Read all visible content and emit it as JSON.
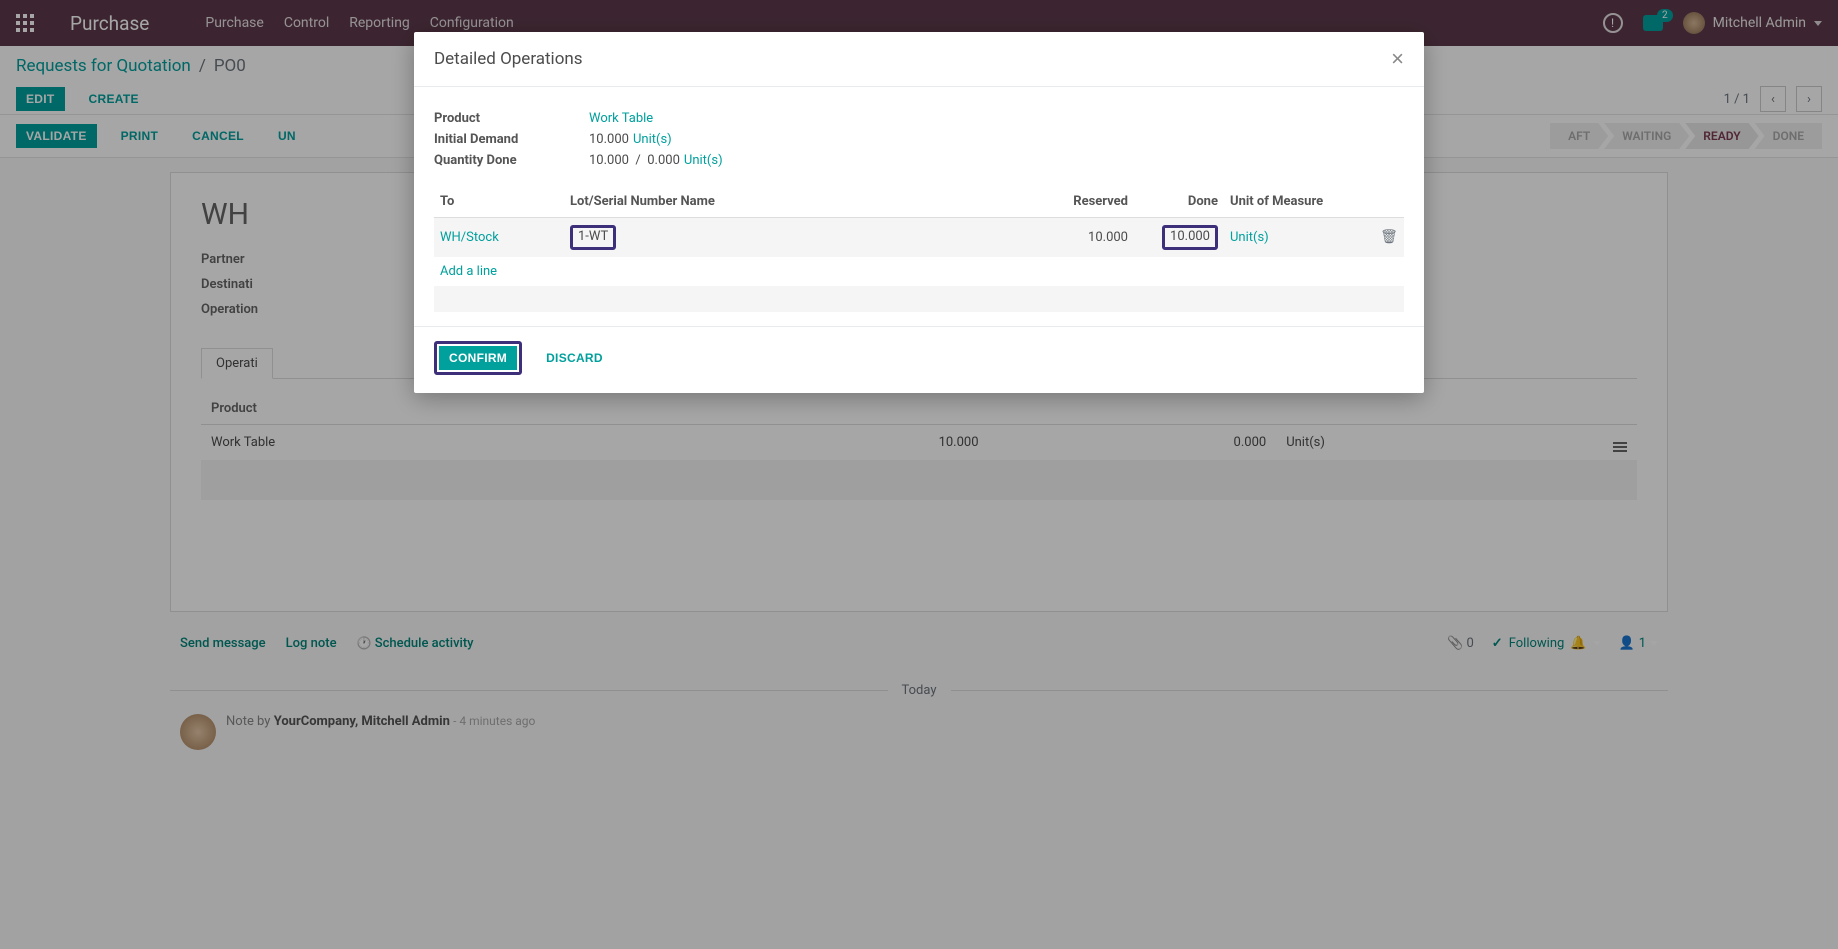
{
  "topbar": {
    "brand": "Purchase",
    "menu": [
      "Purchase",
      "Control",
      "Reporting",
      "Configuration"
    ],
    "chat_badge": "2",
    "user_name": "Mitchell Admin"
  },
  "breadcrumb": {
    "root": "Requests for Quotation",
    "current": "PO0",
    "edit": "Edit",
    "create": "Create",
    "pager": "1 / 1"
  },
  "statusbar": {
    "validate": "Validate",
    "print": "Print",
    "cancel": "Cancel",
    "un": "Un",
    "stages": [
      "aft",
      "Waiting",
      "Ready",
      "Done"
    ],
    "active_stage_index": 2
  },
  "sheet": {
    "doc_title": "WH",
    "labels": {
      "partner": "Partner",
      "destination": "Destinati",
      "operation": "Operation"
    },
    "tab_label": "Operati",
    "table": {
      "th_product": "Product",
      "row_product": "Work Table",
      "row_demand": "10.000",
      "row_done": "0.000",
      "row_uom": "Unit(s)"
    }
  },
  "chatter": {
    "send_message": "Send message",
    "log_note": "Log note",
    "schedule_activity": "Schedule activity",
    "attach_count": "0",
    "following": "Following",
    "followers": "1",
    "today": "Today",
    "note_prefix": "Note by",
    "note_author": "YourCompany, Mitchell Admin",
    "note_ago": "- 4 minutes ago"
  },
  "modal": {
    "title": "Detailed Operations",
    "labels": {
      "product": "Product",
      "initial_demand": "Initial Demand",
      "quantity_done": "Quantity Done"
    },
    "product": "Work Table",
    "initial_demand_qty": "10.000",
    "initial_demand_uom": "Unit(s)",
    "qty_done_a": "10.000",
    "qty_done_sep": "/",
    "qty_done_b": "0.000",
    "qty_done_uom": "Unit(s)",
    "table": {
      "th": {
        "to": "To",
        "lot": "Lot/Serial Number Name",
        "reserved": "Reserved",
        "done": "Done",
        "uom": "Unit of Measure"
      },
      "row": {
        "to": "WH/Stock",
        "lot": "1-WT",
        "reserved": "10.000",
        "done": "10.000",
        "uom": "Unit(s)"
      },
      "add_line": "Add a line"
    },
    "confirm": "Confirm",
    "discard": "Discard"
  }
}
